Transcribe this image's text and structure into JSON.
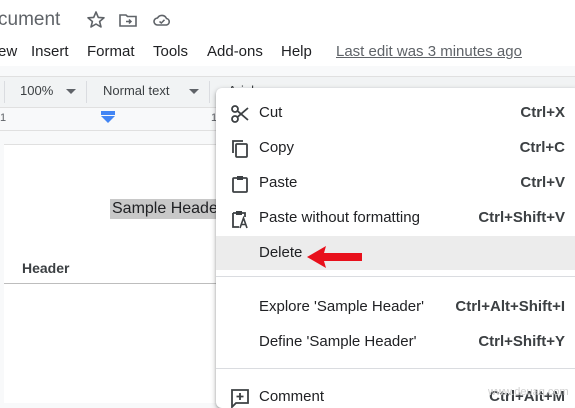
{
  "title_bar": {
    "doc_title": "cument"
  },
  "menubar": {
    "items": [
      "ew",
      "Insert",
      "Format",
      "Tools",
      "Add-ons",
      "Help"
    ],
    "last_edit": "Last edit was 3 minutes ago"
  },
  "toolbar": {
    "zoom": "100%",
    "style": "Normal text",
    "font": "Arial"
  },
  "ruler": {
    "left_number": "1",
    "right_number": "1"
  },
  "document": {
    "selected_text": "Sample Header",
    "header_label": "Header"
  },
  "context_menu": {
    "items": [
      {
        "icon": "scissors-icon",
        "label": "Cut",
        "shortcut": "Ctrl+X"
      },
      {
        "icon": "copy-icon",
        "label": "Copy",
        "shortcut": "Ctrl+C"
      },
      {
        "icon": "clipboard-icon",
        "label": "Paste",
        "shortcut": "Ctrl+V"
      },
      {
        "icon": "paste-plain-icon",
        "label": "Paste without formatting",
        "shortcut": "Ctrl+Shift+V"
      },
      {
        "icon": "",
        "label": "Delete",
        "shortcut": "",
        "highlighted": true
      },
      {
        "icon": "",
        "label": "Explore 'Sample Header'",
        "shortcut": "Ctrl+Alt+Shift+I"
      },
      {
        "icon": "",
        "label": "Define 'Sample Header'",
        "shortcut": "Ctrl+Shift+Y"
      },
      {
        "icon": "add-comment-icon",
        "label": "Comment",
        "shortcut": "Ctrl+Alt+M"
      }
    ]
  },
  "watermark": "www.deuaq.com",
  "colors": {
    "arrow": "#e8101c",
    "indent_marker": "#4285f4",
    "hover": "#ececec"
  }
}
